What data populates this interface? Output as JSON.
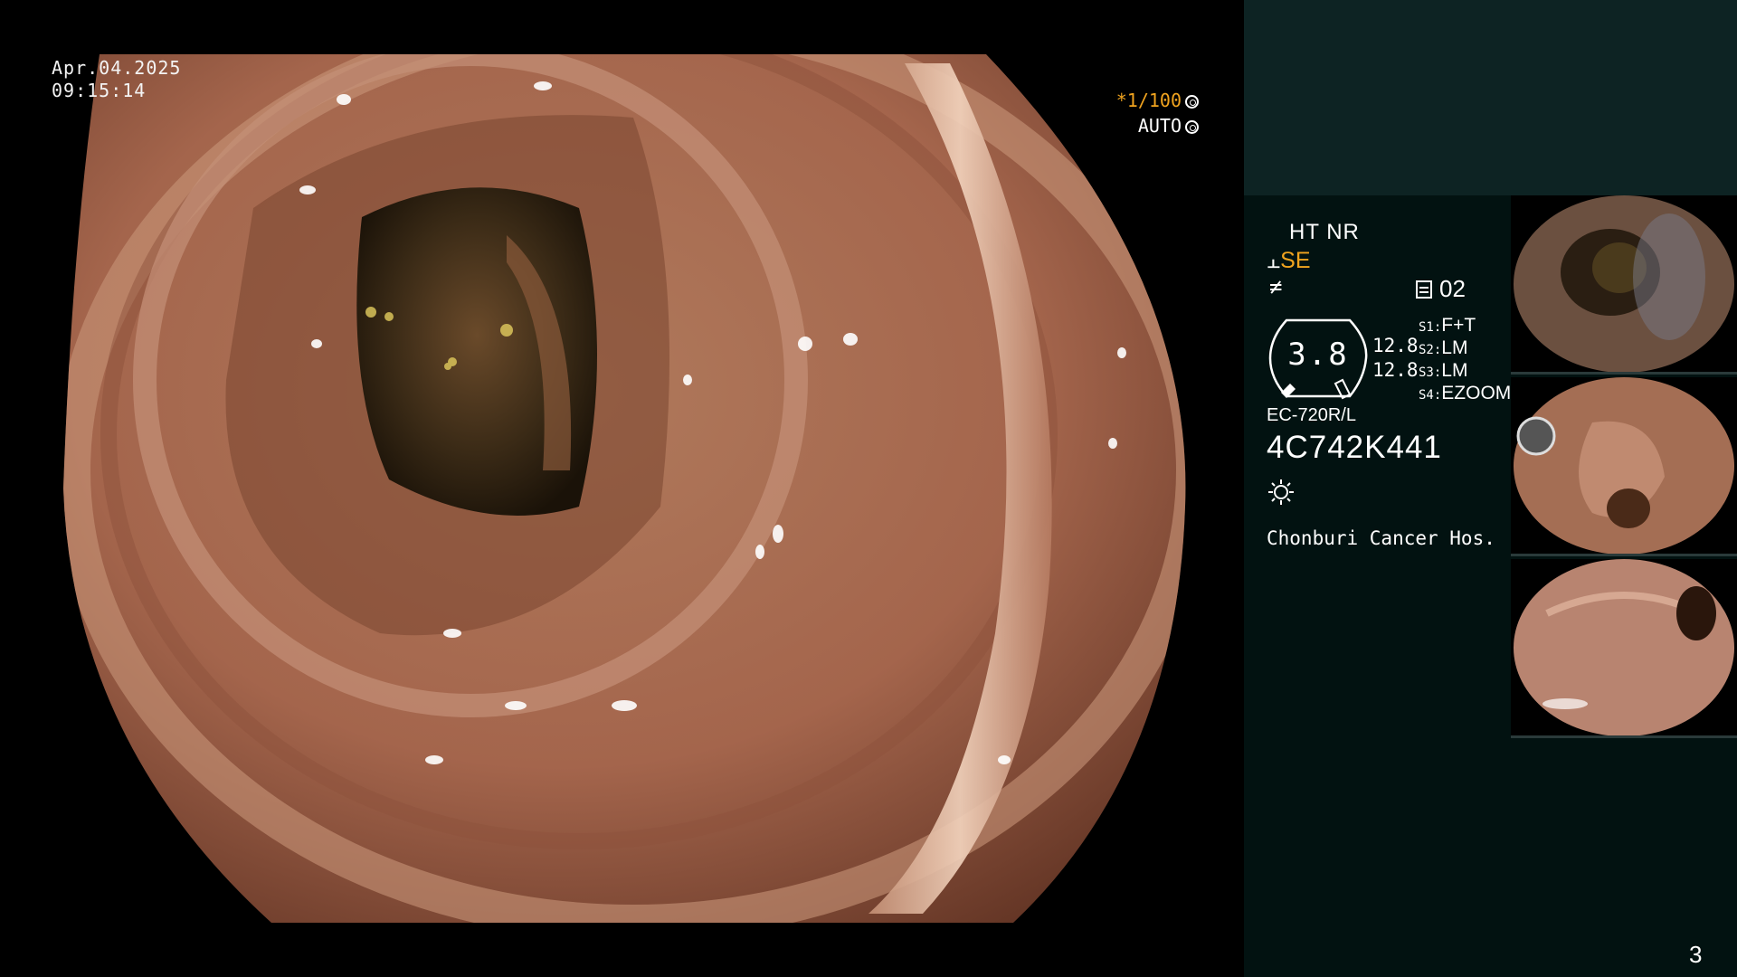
{
  "overlay": {
    "date": "Apr.04.2025",
    "time": "09:15:14",
    "shutter_speed": "*1/100",
    "shutter_mode": "AUTO"
  },
  "panel": {
    "mode": "HT NR",
    "enhance": "SE",
    "preset": "02",
    "gauge_value": "3.8",
    "values": [
      "12.8",
      "12.8"
    ],
    "switches": [
      {
        "key": "S1:",
        "value": "F+T"
      },
      {
        "key": "S2:",
        "value": "LM"
      },
      {
        "key": "S3:",
        "value": "LM"
      },
      {
        "key": "S4:",
        "value": "EZOOM"
      }
    ],
    "scope_model": "EC-720R/L",
    "serial": "4C742K441",
    "hospital": "Chonburi Cancer Hos.",
    "page_number": "3"
  },
  "colors": {
    "accent": "#f1a41f",
    "panel_bg": "#021211",
    "panel_top_bg": "#0d2323"
  },
  "icons": [
    "shutter-circle-icon",
    "auto-circle-icon",
    "enhance-icon",
    "slash-icon",
    "preset-doc-icon",
    "light-icon"
  ]
}
